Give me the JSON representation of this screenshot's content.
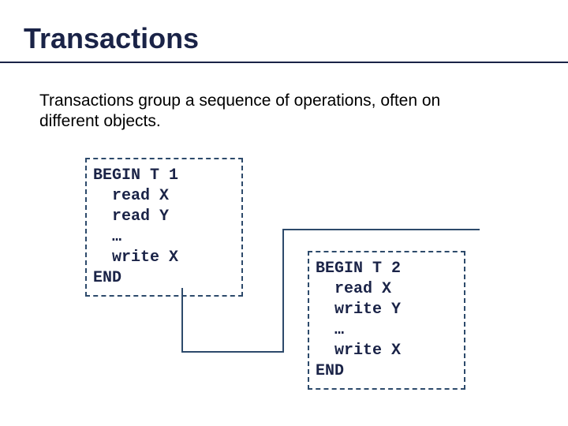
{
  "title": "Transactions",
  "subtitle": "Transactions group a sequence of operations, often on different objects.",
  "transaction1": "BEGIN T 1\n  read X\n  read Y\n  …\n  write X\nEND",
  "transaction2": "BEGIN T 2\n  read X\n  write Y\n  …\n  write X\nEND"
}
